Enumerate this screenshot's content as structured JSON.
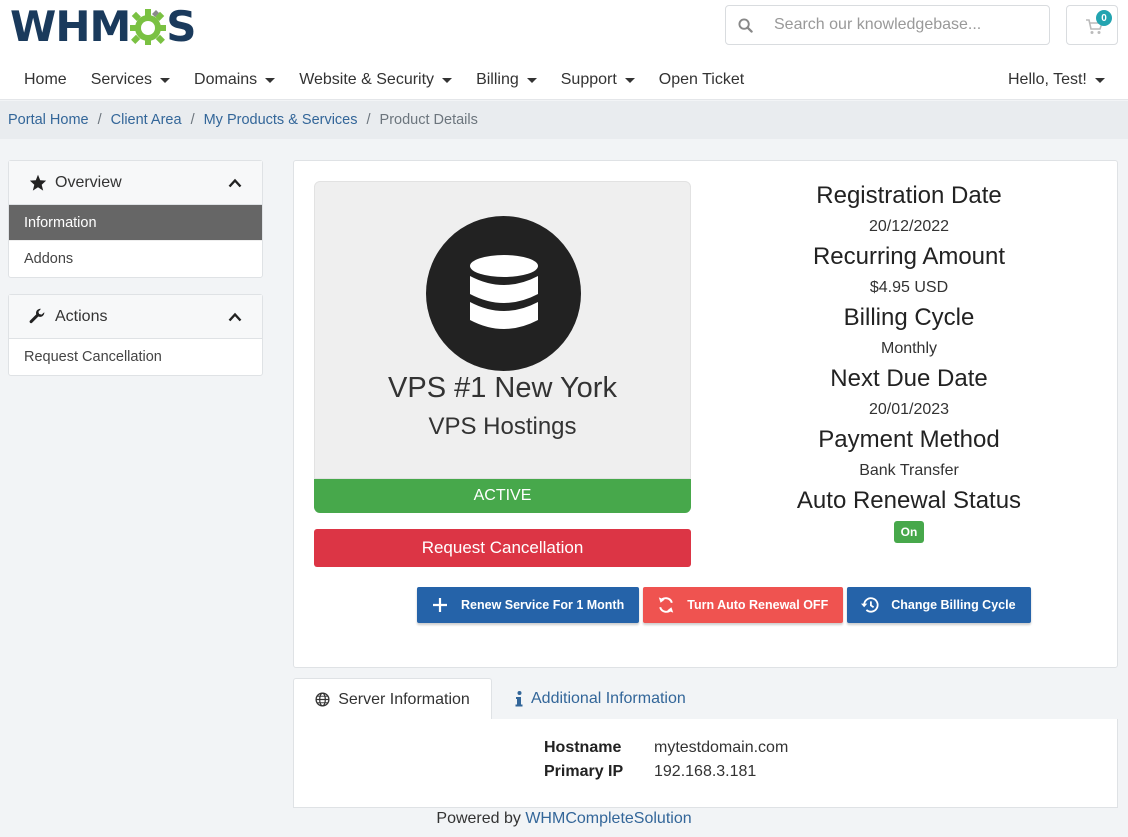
{
  "brand": {
    "logo_text_left": "WHM",
    "logo_text_right": "S",
    "accent": "#7ac142",
    "primary": "#1a3a5c"
  },
  "search": {
    "placeholder": "Search our knowledgebase..."
  },
  "cart": {
    "count": "0"
  },
  "nav": {
    "items": [
      {
        "label": "Home",
        "dropdown": false
      },
      {
        "label": "Services",
        "dropdown": true
      },
      {
        "label": "Domains",
        "dropdown": true
      },
      {
        "label": "Website & Security",
        "dropdown": true
      },
      {
        "label": "Billing",
        "dropdown": true
      },
      {
        "label": "Support",
        "dropdown": true
      },
      {
        "label": "Open Ticket",
        "dropdown": false
      }
    ],
    "user_label": "Hello, Test!"
  },
  "breadcrumb": {
    "items": [
      "Portal Home",
      "Client Area",
      "My Products & Services"
    ],
    "current": "Product Details"
  },
  "sidebar": {
    "overview": {
      "title": "Overview",
      "items": [
        "Information",
        "Addons"
      ]
    },
    "actions": {
      "title": "Actions",
      "items": [
        "Request Cancellation"
      ]
    }
  },
  "product": {
    "name": "VPS #1 New York",
    "group": "VPS Hostings",
    "status": "ACTIVE",
    "cancel_label": "Request Cancellation"
  },
  "details": {
    "registration_label": "Registration Date",
    "registration_value": "20/12/2022",
    "recurring_label": "Recurring Amount",
    "recurring_value": "$4.95 USD",
    "cycle_label": "Billing Cycle",
    "cycle_value": "Monthly",
    "due_label": "Next Due Date",
    "due_value": "20/01/2023",
    "payment_label": "Payment Method",
    "payment_value": "Bank Transfer",
    "renewal_label": "Auto Renewal Status",
    "renewal_value": "On"
  },
  "actions": {
    "renew_label": "Renew Service For 1 Month",
    "auto_renew_label": "Turn Auto Renewal OFF",
    "change_cycle_label": "Change Billing Cycle"
  },
  "tabs": {
    "server_label": "Server Information",
    "additional_label": "Additional Information"
  },
  "server": {
    "hostname_label": "Hostname",
    "hostname_value": "mytestdomain.com",
    "ip_label": "Primary IP",
    "ip_value": "192.168.3.181"
  },
  "footer": {
    "prefix": "Powered by ",
    "link": "WHMCompleteSolution"
  }
}
